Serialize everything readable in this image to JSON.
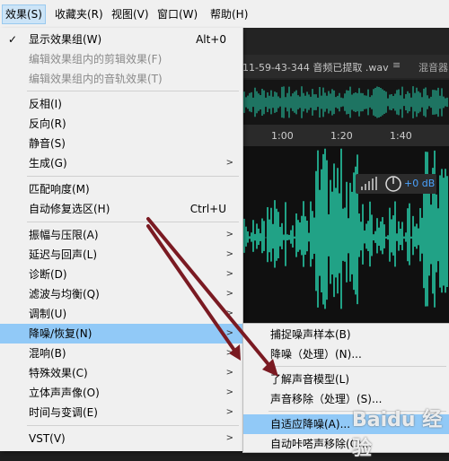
{
  "menubar": {
    "items": [
      "效果(S)",
      "收藏夹(R)",
      "视图(V)",
      "窗口(W)",
      "帮助(H)"
    ]
  },
  "editor": {
    "tab_title": "11-59-43-344 音频已提取 .wav",
    "tab_close": "≡",
    "mixer_tab": "混音器",
    "ruler_ticks": [
      "1:00",
      "1:20",
      "1:40"
    ],
    "hud_level": "+0 dB"
  },
  "menu": {
    "items": [
      {
        "label": "显示效果组(W)",
        "shortcut": "Alt+0",
        "checked": true
      },
      {
        "label": "编辑效果组内的剪辑效果(F)",
        "disabled": true
      },
      {
        "label": "编辑效果组内的音轨效果(T)",
        "disabled": true
      },
      {
        "label": "反相(I)"
      },
      {
        "label": "反向(R)"
      },
      {
        "label": "静音(S)"
      },
      {
        "label": "生成(G)",
        "submenu": true
      },
      {
        "label": "匹配响度(M)"
      },
      {
        "label": "自动修复选区(H)",
        "shortcut": "Ctrl+U"
      },
      {
        "label": "振幅与压限(A)",
        "submenu": true
      },
      {
        "label": "延迟与回声(L)",
        "submenu": true
      },
      {
        "label": "诊断(D)",
        "submenu": true
      },
      {
        "label": "滤波与均衡(Q)",
        "submenu": true
      },
      {
        "label": "调制(U)",
        "submenu": true
      },
      {
        "label": "降噪/恢复(N)",
        "submenu": true,
        "highlighted": true
      },
      {
        "label": "混响(B)",
        "submenu": true
      },
      {
        "label": "特殊效果(C)",
        "submenu": true
      },
      {
        "label": "立体声声像(O)",
        "submenu": true
      },
      {
        "label": "时间与变调(E)",
        "submenu": true
      },
      {
        "label": "VST(V)",
        "submenu": true
      }
    ]
  },
  "submenu": {
    "items": [
      {
        "label": "捕捉噪声样本(B)"
      },
      {
        "label": "降噪（处理）(N)..."
      },
      {
        "label": "了解声音模型(L)"
      },
      {
        "label": "声音移除（处理）(S)..."
      },
      {
        "label": "自适应降噪(A)...",
        "highlighted": true
      },
      {
        "label": "自动咔嗒声移除(C)..."
      }
    ]
  },
  "icons": {
    "check": "check-icon",
    "submenu_arrow": "chevron-right-icon",
    "knob": "knob-icon",
    "level": "level-meter-icon"
  },
  "colors": {
    "waveform": "#27d3ae",
    "highlight": "#91c9f7",
    "annotation_arrow": "#7a1a22"
  },
  "watermark": "Baidu 经验"
}
